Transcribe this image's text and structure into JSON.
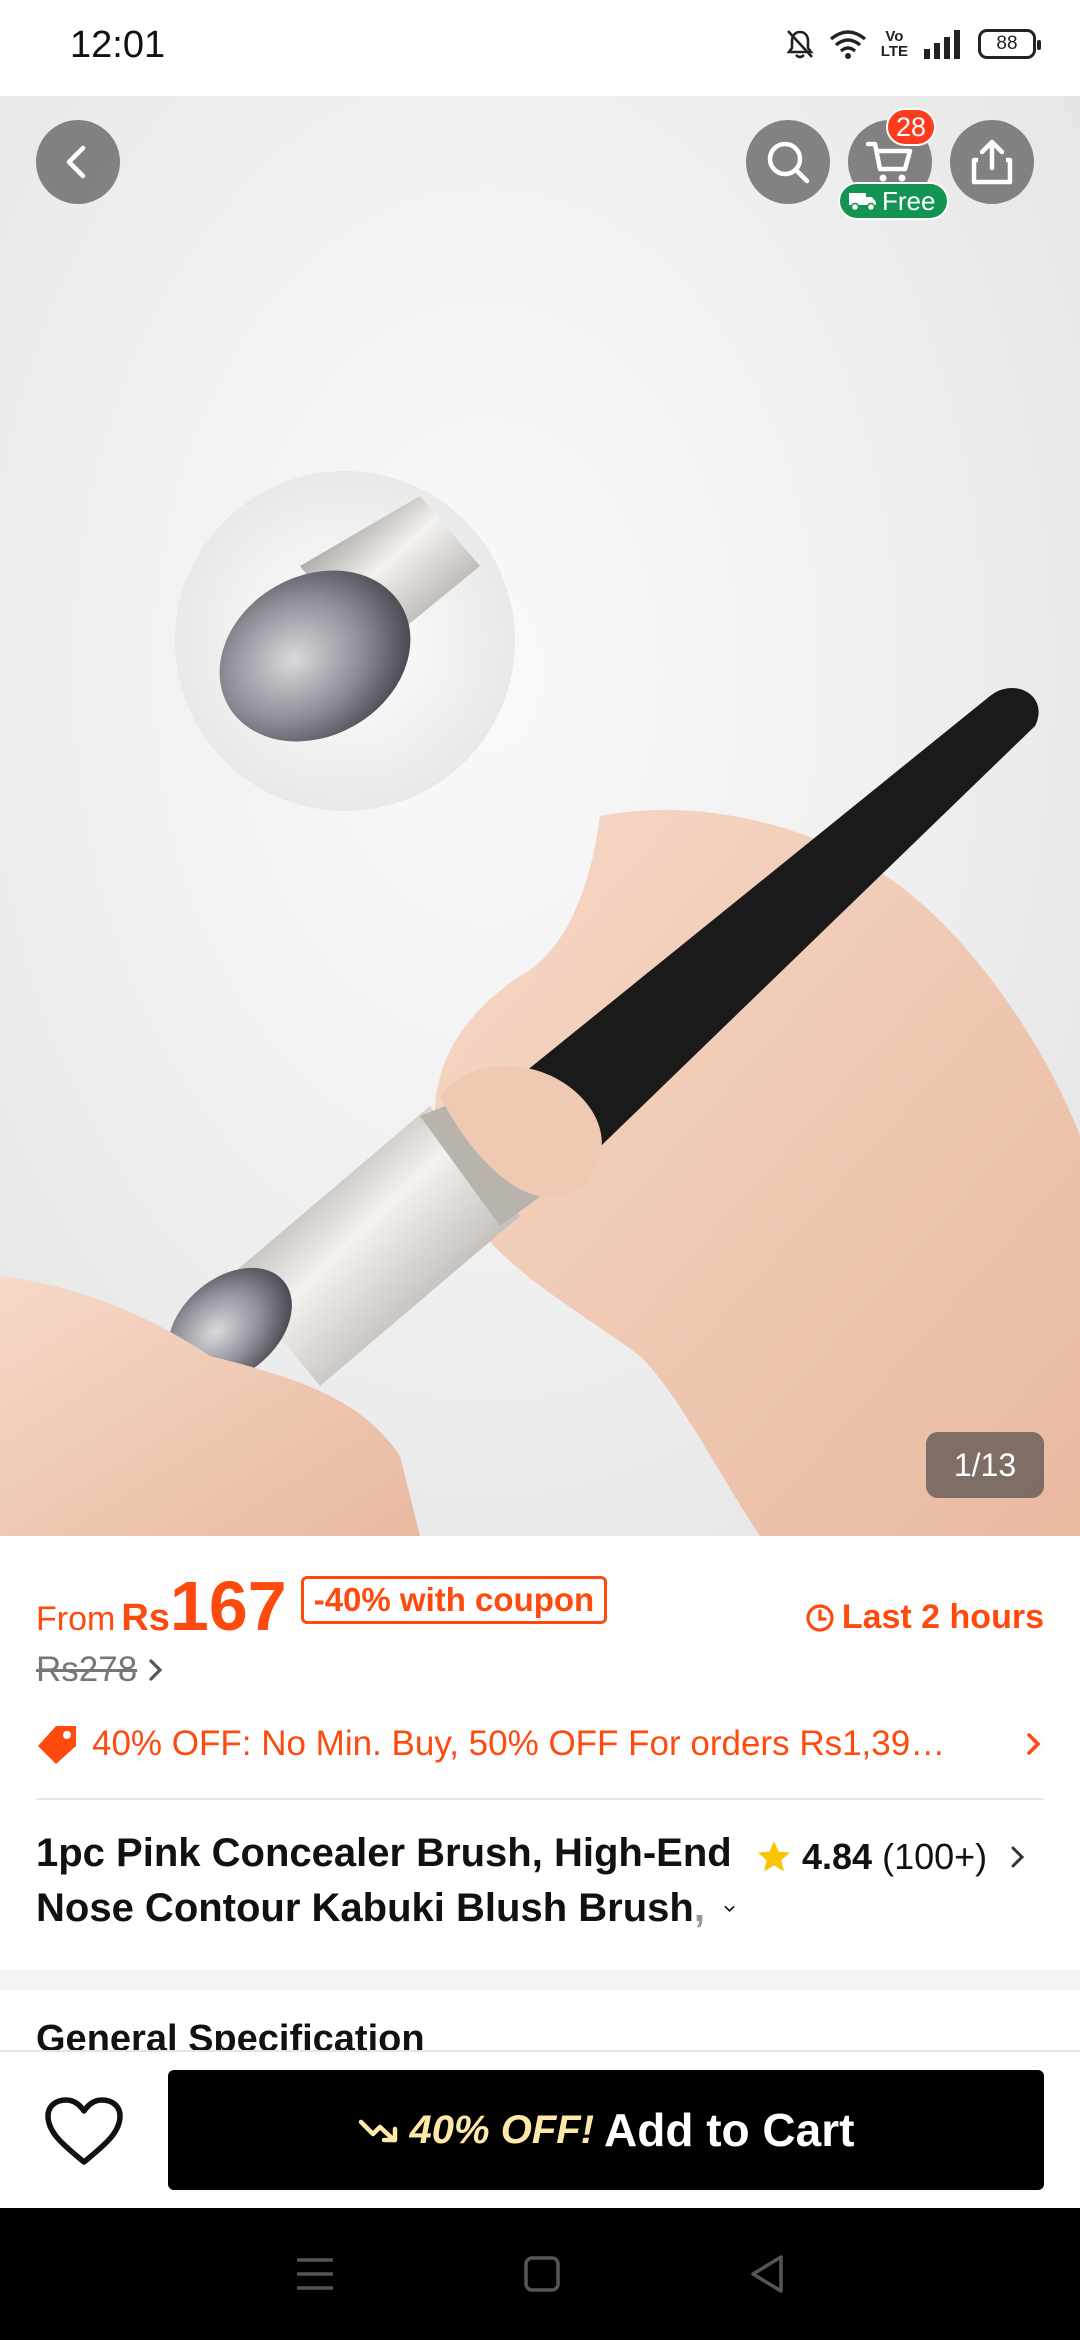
{
  "status_bar": {
    "time": "12:01",
    "battery": "88"
  },
  "header": {
    "cart_count": "28",
    "free_label": "Free"
  },
  "gallery": {
    "counter": "1/13"
  },
  "price": {
    "from_label": "From",
    "currency": "Rs",
    "value": "167",
    "coupon": "-40% with coupon",
    "timer": "Last 2 hours",
    "original_price": "Rs278"
  },
  "promo": {
    "text": "40% OFF: No Min. Buy,  50% OFF For orders Rs1,39…"
  },
  "product": {
    "title_line1": "1pc Pink Concealer Brush, High-End",
    "title_line2": "Nose Contour Kabuki Blush Brush",
    "title_fade": ",",
    "rating": "4.84",
    "reviews": "(100+)"
  },
  "specs": {
    "heading": "General Specification"
  },
  "action_bar": {
    "discount_label": "40% OFF!",
    "add_to_cart_label": "Add to Cart"
  },
  "colors": {
    "accent": "#ff4a0d",
    "free_badge": "#139452",
    "cart_badge": "#ff3b1f",
    "primary_button": "#000000"
  }
}
